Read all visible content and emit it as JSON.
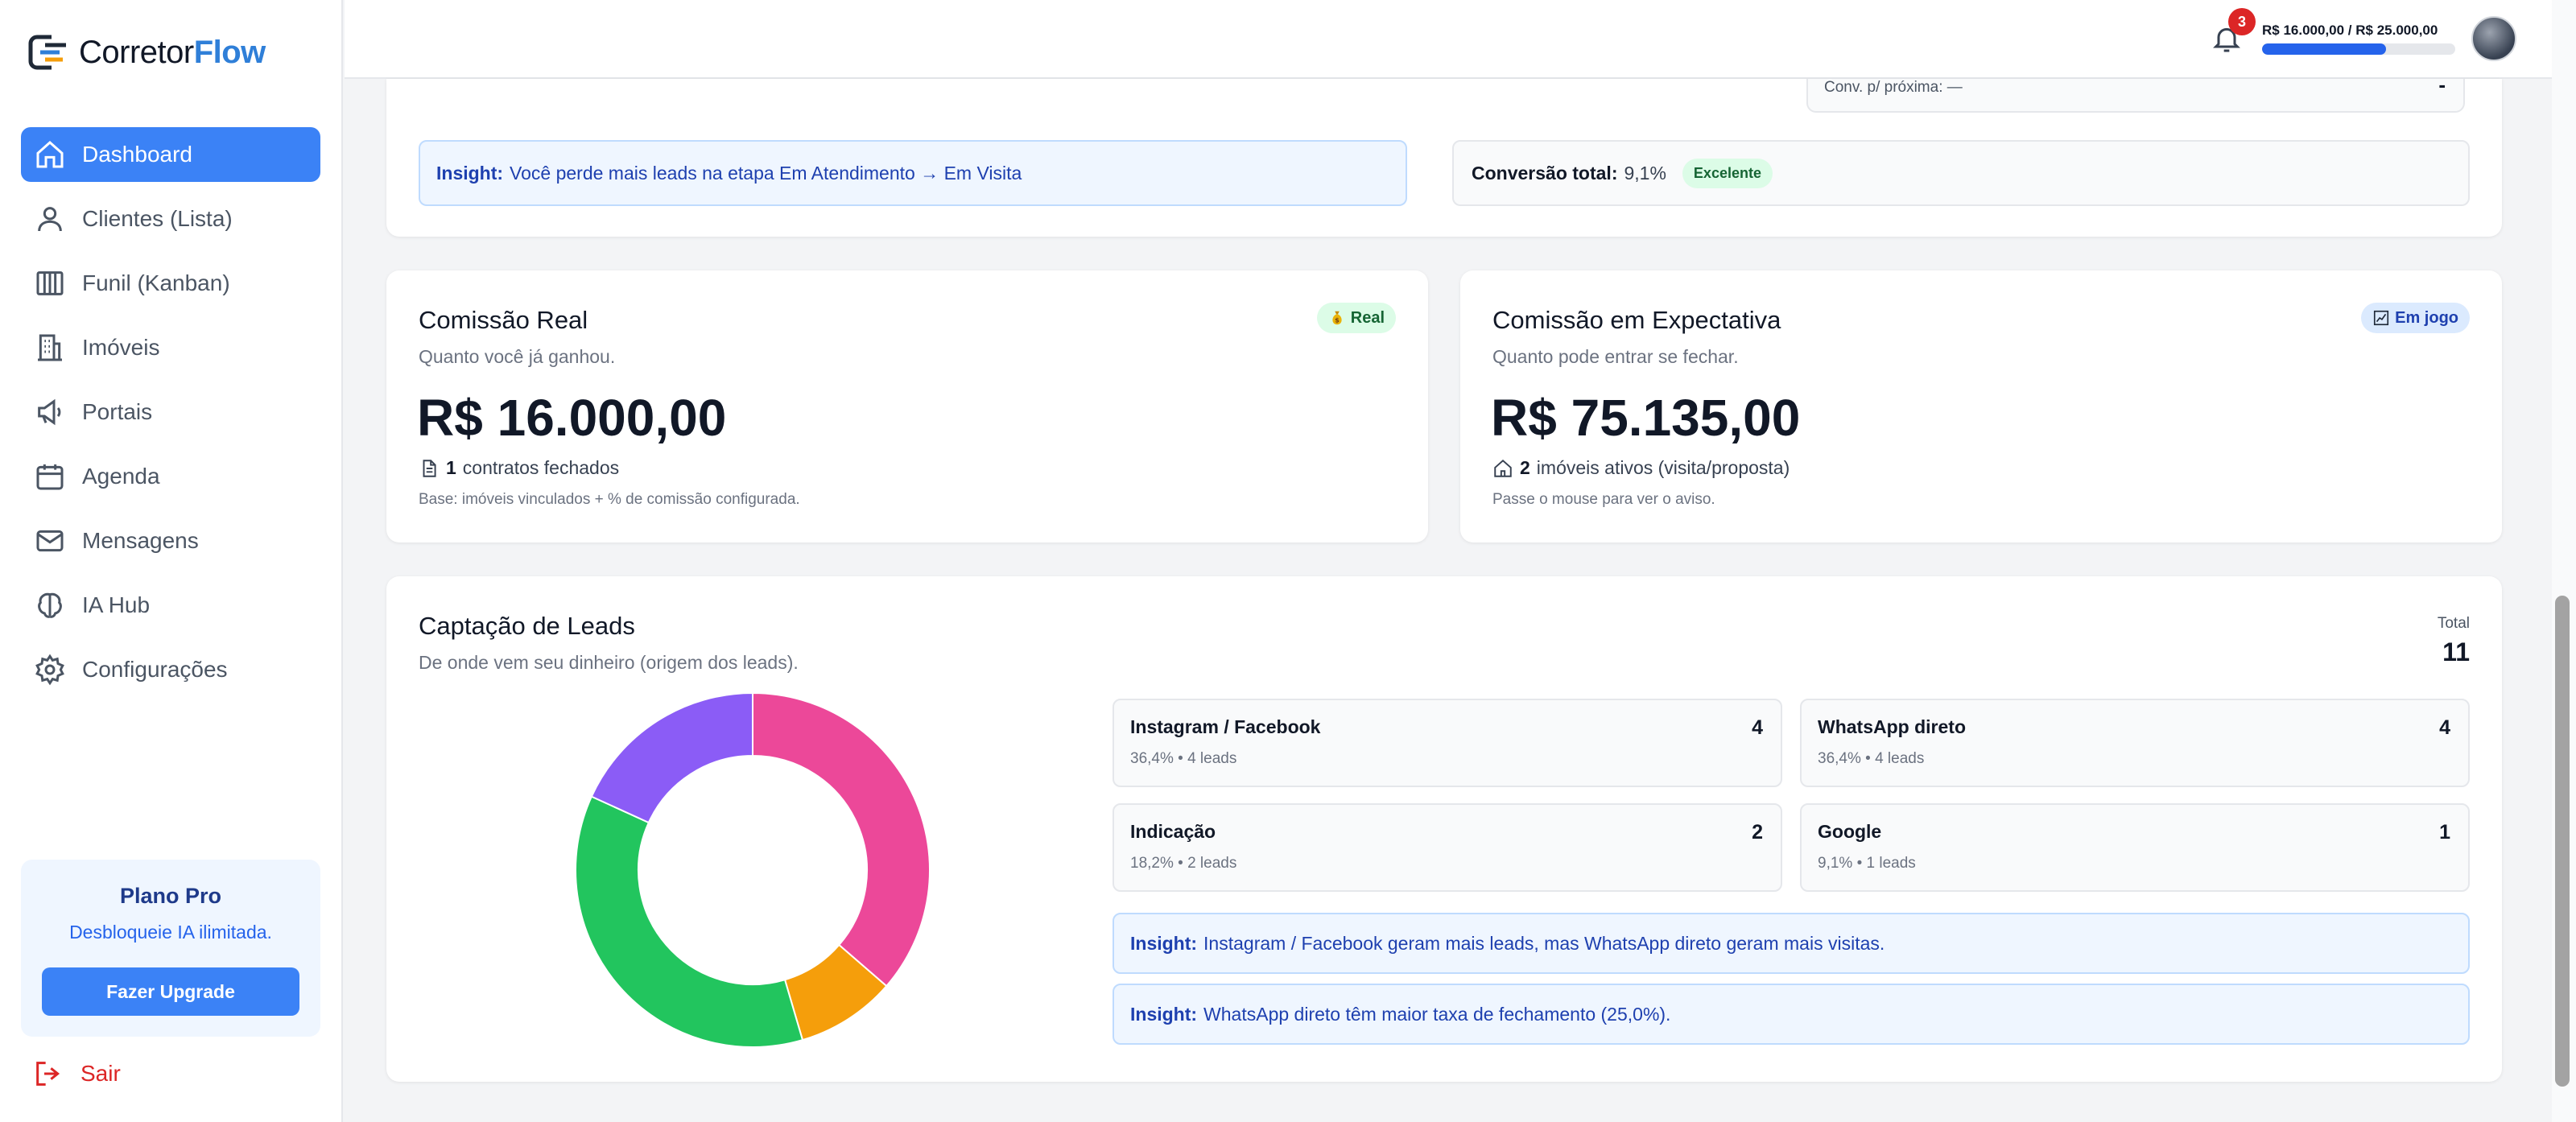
{
  "app": {
    "logo_main": "Corretor",
    "logo_accent": "Flow"
  },
  "sidebar": {
    "items": [
      {
        "label": "Dashboard",
        "icon": "home-icon",
        "active": true
      },
      {
        "label": "Clientes (Lista)",
        "icon": "user-icon",
        "active": false
      },
      {
        "label": "Funil (Kanban)",
        "icon": "kanban-icon",
        "active": false
      },
      {
        "label": "Imóveis",
        "icon": "building-icon",
        "active": false
      },
      {
        "label": "Portais",
        "icon": "megaphone-icon",
        "active": false
      },
      {
        "label": "Agenda",
        "icon": "calendar-icon",
        "active": false
      },
      {
        "label": "Mensagens",
        "icon": "mail-icon",
        "active": false
      },
      {
        "label": "IA Hub",
        "icon": "brain-icon",
        "active": false
      },
      {
        "label": "Configurações",
        "icon": "gear-icon",
        "active": false
      }
    ],
    "plan": {
      "title": "Plano Pro",
      "subtitle": "Desbloqueie IA ilimitada.",
      "button": "Fazer Upgrade"
    },
    "logout": "Sair"
  },
  "header": {
    "notifications": "3",
    "goal_text": "R$ 16.000,00 / R$ 25.000,00",
    "goal_progress": 0.64
  },
  "funnel": {
    "stage_conv_label": "Conv. p/ próxima: —",
    "stage_value": "-",
    "insight_label": "Insight:",
    "insight_text": "Você perde mais leads na etapa Em Atendimento → Em Visita",
    "conversion_label": "Conversão total:",
    "conversion_value": "9,1%",
    "conversion_badge": "Excelente"
  },
  "commission_real": {
    "title": "Comissão Real",
    "badge": "Real",
    "subtitle": "Quanto você já ganhou.",
    "value": "R$ 16.000,00",
    "count": "1",
    "count_label": "contratos fechados",
    "note": "Base: imóveis vinculados + % de comissão configurada."
  },
  "commission_expected": {
    "title": "Comissão em Expectativa",
    "badge": "Em jogo",
    "subtitle": "Quanto pode entrar se fechar.",
    "value": "R$ 75.135,00",
    "count": "2",
    "count_label": "imóveis ativos (visita/proposta)",
    "note": "Passe o mouse para ver o aviso."
  },
  "leads": {
    "title": "Captação de Leads",
    "subtitle": "De onde vem seu dinheiro (origem dos leads).",
    "total_label": "Total",
    "total_value": "11",
    "sources": [
      {
        "name": "Instagram / Facebook",
        "meta": "36,4% • 4 leads",
        "count": "4"
      },
      {
        "name": "WhatsApp direto",
        "meta": "36,4% • 4 leads",
        "count": "4"
      },
      {
        "name": "Indicação",
        "meta": "18,2% • 2 leads",
        "count": "2"
      },
      {
        "name": "Google",
        "meta": "9,1% • 1 leads",
        "count": "1"
      }
    ],
    "insights": [
      {
        "label": "Insight:",
        "text": "Instagram / Facebook geram mais leads, mas WhatsApp direto geram mais visitas."
      },
      {
        "label": "Insight:",
        "text": "WhatsApp direto têm maior taxa de fechamento (25,0%)."
      }
    ]
  },
  "chart_data": {
    "type": "pie",
    "slices": [
      {
        "label": "Instagram / Facebook",
        "value": 4,
        "color": "#ec4899"
      },
      {
        "label": "Google",
        "value": 1,
        "color": "#f59e0b"
      },
      {
        "label": "WhatsApp direto",
        "value": 4,
        "color": "#22c55e"
      },
      {
        "label": "Indicação",
        "value": 2,
        "color": "#8b5cf6"
      }
    ]
  },
  "colors": {
    "primary": "#3b82f6",
    "danger": "#dc2626",
    "success": "#22c55e"
  }
}
